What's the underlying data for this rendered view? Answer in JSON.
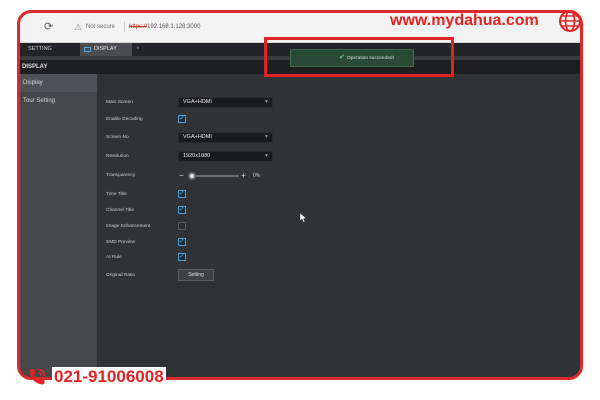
{
  "watermark": {
    "site": "www.mydahua.com",
    "phone": "021-91006008",
    "color": "#e02424"
  },
  "browser": {
    "not_secure": "Not secure",
    "url_protocol": "https://",
    "url_host": "192.168.1.128:3000"
  },
  "tabs": {
    "setting": "SETTING",
    "display": "DISPLAY",
    "close": "×"
  },
  "page": {
    "title": "DISPLAY"
  },
  "sidebar": {
    "items": [
      {
        "label": "Display"
      },
      {
        "label": "Tour Setting"
      }
    ]
  },
  "form": {
    "main_screen": {
      "label": "Main Screen",
      "value": "VGA+HDMI"
    },
    "enable_decoding": {
      "label": "Enable Decoding",
      "checked": true
    },
    "screen_no": {
      "label": "Screen No.",
      "value": "VGA+HDMI"
    },
    "resolution": {
      "label": "Resolution",
      "value": "1920x1080"
    },
    "transparency": {
      "label": "Transparency",
      "value": "0%",
      "minus": "−",
      "plus": "+"
    },
    "time_title": {
      "label": "Time Title",
      "checked": true
    },
    "channel_title": {
      "label": "Channel Title",
      "checked": true
    },
    "image_enhancement": {
      "label": "Image Enhancement",
      "checked": false
    },
    "smd_preview": {
      "label": "SMD Preview",
      "checked": true
    },
    "ai_rule": {
      "label": "AI Rule",
      "checked": true
    },
    "original_ratio": {
      "label": "Original Ratio",
      "button": "Setting"
    }
  },
  "toast": {
    "message": "Operation succeeded!",
    "icon": "check-icon"
  }
}
